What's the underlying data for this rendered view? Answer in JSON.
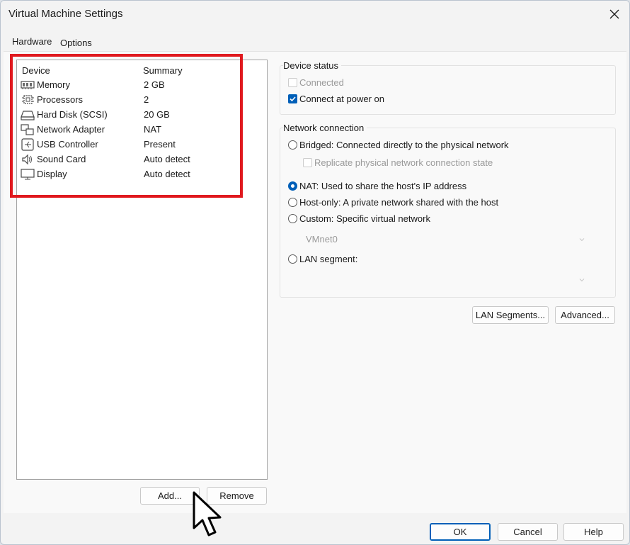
{
  "window": {
    "title": "Virtual Machine Settings",
    "close_glyph": "✕"
  },
  "tabs": [
    {
      "label": "Hardware",
      "active": true
    },
    {
      "label": "Options",
      "active": false
    }
  ],
  "device_list": {
    "columns": {
      "device": "Device",
      "summary": "Summary"
    },
    "rows": [
      {
        "icon": "memory-icon",
        "name": "Memory",
        "summary": "2 GB"
      },
      {
        "icon": "processor-icon",
        "name": "Processors",
        "summary": "2"
      },
      {
        "icon": "hard-disk-icon",
        "name": "Hard Disk (SCSI)",
        "summary": "20 GB"
      },
      {
        "icon": "network-adapter-icon",
        "name": "Network Adapter",
        "summary": "NAT"
      },
      {
        "icon": "usb-icon",
        "name": "USB Controller",
        "summary": "Present"
      },
      {
        "icon": "speaker-icon",
        "name": "Sound Card",
        "summary": "Auto detect"
      },
      {
        "icon": "display-icon",
        "name": "Display",
        "summary": "Auto detect"
      }
    ]
  },
  "list_buttons": {
    "add": "Add...",
    "remove": "Remove"
  },
  "device_status": {
    "title": "Device status",
    "connected": {
      "label": "Connected",
      "checked": false,
      "enabled": false
    },
    "connect_at_power_on": {
      "label": "Connect at power on",
      "checked": true,
      "enabled": true
    }
  },
  "network_connection": {
    "title": "Network connection",
    "bridged": {
      "label": "Bridged: Connected directly to the physical network",
      "checked": false
    },
    "replicate": {
      "label": "Replicate physical network connection state",
      "checked": false,
      "enabled": false
    },
    "nat": {
      "label": "NAT: Used to share the host's IP address",
      "checked": true
    },
    "host_only": {
      "label": "Host-only: A private network shared with the host",
      "checked": false
    },
    "custom": {
      "label": "Custom: Specific virtual network",
      "checked": false
    },
    "custom_select_value": "VMnet0",
    "lan_segment": {
      "label": "LAN segment:",
      "checked": false
    },
    "lan_select_value": ""
  },
  "network_buttons": {
    "lan_segments": "LAN Segments...",
    "advanced": "Advanced..."
  },
  "dialog_buttons": {
    "ok": "OK",
    "cancel": "Cancel",
    "help": "Help"
  },
  "colors": {
    "accent": "#005fb8",
    "highlight": "#e0191e"
  }
}
